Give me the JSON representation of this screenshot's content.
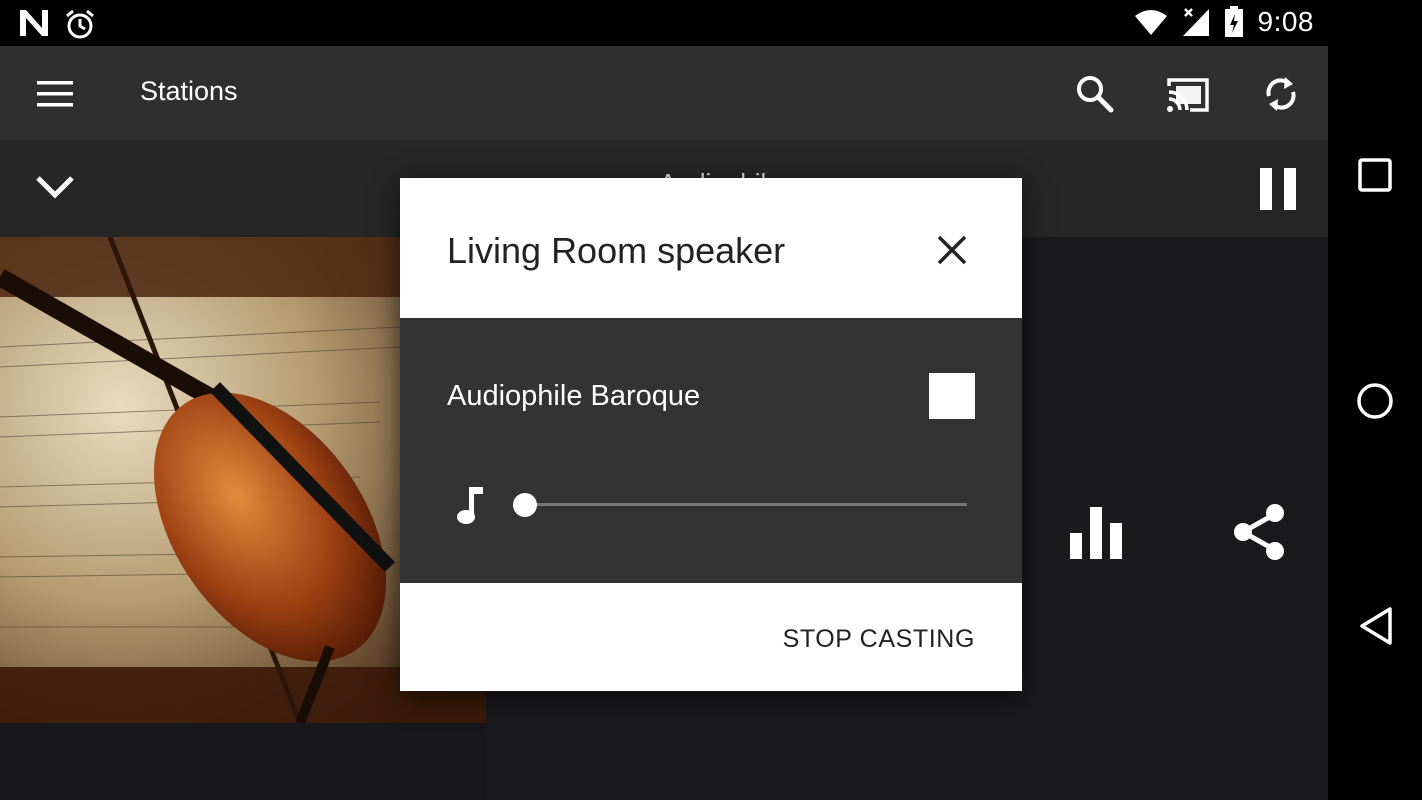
{
  "status_bar": {
    "time": "9:08",
    "icons": [
      "notification-n-icon",
      "alarm-icon",
      "wifi-icon",
      "cell-no-signal-icon",
      "battery-charging-icon"
    ]
  },
  "toolbar": {
    "title": "Stations",
    "icons": [
      "menu-icon",
      "search-icon",
      "cast-connected-icon",
      "sync-icon"
    ]
  },
  "mini_player": {
    "title": "Audiophile",
    "icons": [
      "chevron-down-icon",
      "pause-icon"
    ]
  },
  "player_actions": {
    "icons": [
      "equalizer-icon",
      "share-icon"
    ]
  },
  "cast_dialog": {
    "title": "Living Room speaker",
    "media_title": "Audiophile Baroque",
    "volume": 0.0,
    "stop_label": "STOP CASTING",
    "icons": [
      "close-icon",
      "stop-icon",
      "music-note-icon"
    ]
  },
  "nav_bar": {
    "icons": [
      "recents-square-icon",
      "home-circle-icon",
      "back-triangle-icon"
    ]
  },
  "colors": {
    "toolbar": "#2f2f2f",
    "dialog_body": "#333333",
    "dialog_surface": "#ffffff",
    "background": "#18181c"
  }
}
